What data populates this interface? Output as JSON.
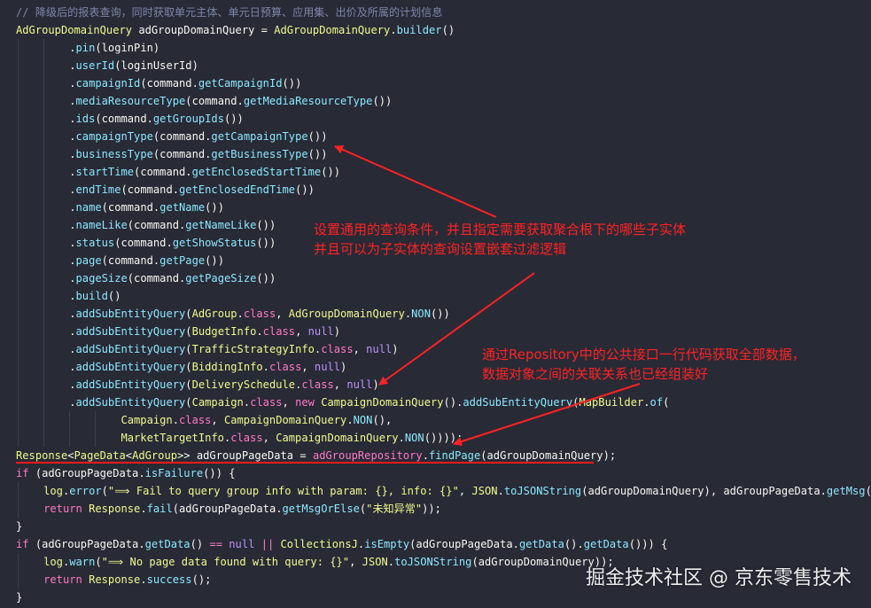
{
  "annotations": {
    "note1_line1": "设置通用的查询条件，并且指定需要获取聚合根下的哪些子实体",
    "note1_line2": "并且可以为子实体的查询设置嵌套过滤逻辑",
    "note2_line1": "通过Repository中的公共接口一行代码获取全部数据，",
    "note2_line2": "数据对象之间的关联关系也已经组装好",
    "color": "#ff2222"
  },
  "watermark": "掘金技术社区 @ 京东零售技术",
  "theme": {
    "background": "#282a36",
    "comment": "#7f86a8",
    "type": "#f1fa8c",
    "function": "#8be9fd",
    "keyword": "#ff79c6",
    "constant": "#bd93f9"
  },
  "code": {
    "lines": [
      {
        "indent": 0,
        "tokens": [
          [
            "cm",
            "// 降级后的报表查询，同时获取单元主体、单元日预算、应用集、出价及所属的计划信息"
          ]
        ]
      },
      {
        "indent": 0,
        "tokens": [
          [
            "ty",
            "AdGroupDomainQuery"
          ],
          [
            "pl",
            " adGroupDomainQuery = "
          ],
          [
            "ty",
            "AdGroupDomainQuery"
          ],
          [
            "pl",
            "."
          ],
          [
            "fn",
            "builder"
          ],
          [
            "pl",
            "()"
          ]
        ]
      },
      {
        "indent": 2,
        "tokens": [
          [
            "pl",
            "."
          ],
          [
            "fn",
            "pin"
          ],
          [
            "pl",
            "(loginPin)"
          ]
        ]
      },
      {
        "indent": 2,
        "tokens": [
          [
            "pl",
            "."
          ],
          [
            "fn",
            "userId"
          ],
          [
            "pl",
            "(loginUserId)"
          ]
        ]
      },
      {
        "indent": 2,
        "tokens": [
          [
            "pl",
            "."
          ],
          [
            "fn",
            "campaignId"
          ],
          [
            "pl",
            "(command."
          ],
          [
            "fn",
            "getCampaignId"
          ],
          [
            "pl",
            "())"
          ]
        ]
      },
      {
        "indent": 2,
        "tokens": [
          [
            "pl",
            "."
          ],
          [
            "fn",
            "mediaResourceType"
          ],
          [
            "pl",
            "(command."
          ],
          [
            "fn",
            "getMediaResourceType"
          ],
          [
            "pl",
            "())"
          ]
        ]
      },
      {
        "indent": 2,
        "tokens": [
          [
            "pl",
            "."
          ],
          [
            "fn",
            "ids"
          ],
          [
            "pl",
            "(command."
          ],
          [
            "fn",
            "getGroupIds"
          ],
          [
            "pl",
            "())"
          ]
        ]
      },
      {
        "indent": 2,
        "tokens": [
          [
            "pl",
            "."
          ],
          [
            "fn",
            "campaignType"
          ],
          [
            "pl",
            "(command."
          ],
          [
            "fn",
            "getCampaignType"
          ],
          [
            "pl",
            "())"
          ]
        ]
      },
      {
        "indent": 2,
        "tokens": [
          [
            "pl",
            "."
          ],
          [
            "fn",
            "businessType"
          ],
          [
            "pl",
            "(command."
          ],
          [
            "fn",
            "getBusinessType"
          ],
          [
            "pl",
            "())"
          ]
        ]
      },
      {
        "indent": 2,
        "tokens": [
          [
            "pl",
            "."
          ],
          [
            "fn",
            "startTime"
          ],
          [
            "pl",
            "(command."
          ],
          [
            "fn",
            "getEnclosedStartTime"
          ],
          [
            "pl",
            "())"
          ]
        ]
      },
      {
        "indent": 2,
        "tokens": [
          [
            "pl",
            "."
          ],
          [
            "fn",
            "endTime"
          ],
          [
            "pl",
            "(command."
          ],
          [
            "fn",
            "getEnclosedEndTime"
          ],
          [
            "pl",
            "())"
          ]
        ]
      },
      {
        "indent": 2,
        "tokens": [
          [
            "pl",
            "."
          ],
          [
            "fn",
            "name"
          ],
          [
            "pl",
            "(command."
          ],
          [
            "fn",
            "getName"
          ],
          [
            "pl",
            "())"
          ]
        ]
      },
      {
        "indent": 2,
        "tokens": [
          [
            "pl",
            "."
          ],
          [
            "fn",
            "nameLike"
          ],
          [
            "pl",
            "(command."
          ],
          [
            "fn",
            "getNameLike"
          ],
          [
            "pl",
            "())"
          ]
        ]
      },
      {
        "indent": 2,
        "tokens": [
          [
            "pl",
            "."
          ],
          [
            "fn",
            "status"
          ],
          [
            "pl",
            "(command."
          ],
          [
            "fn",
            "getShowStatus"
          ],
          [
            "pl",
            "())"
          ]
        ]
      },
      {
        "indent": 2,
        "tokens": [
          [
            "pl",
            "."
          ],
          [
            "fn",
            "page"
          ],
          [
            "pl",
            "(command."
          ],
          [
            "fn",
            "getPage"
          ],
          [
            "pl",
            "())"
          ]
        ]
      },
      {
        "indent": 2,
        "tokens": [
          [
            "pl",
            "."
          ],
          [
            "fn",
            "pageSize"
          ],
          [
            "pl",
            "(command."
          ],
          [
            "fn",
            "getPageSize"
          ],
          [
            "pl",
            "())"
          ]
        ]
      },
      {
        "indent": 2,
        "tokens": [
          [
            "pl",
            "."
          ],
          [
            "fn",
            "build"
          ],
          [
            "pl",
            "()"
          ]
        ]
      },
      {
        "indent": 2,
        "tokens": [
          [
            "pl",
            "."
          ],
          [
            "fn",
            "addSubEntityQuery"
          ],
          [
            "pl",
            "("
          ],
          [
            "ty",
            "AdGroup"
          ],
          [
            "pl",
            "."
          ],
          [
            "kw",
            "class"
          ],
          [
            "pl",
            ", "
          ],
          [
            "ty",
            "AdGroupDomainQuery"
          ],
          [
            "pl",
            "."
          ],
          [
            "fn",
            "NON"
          ],
          [
            "pl",
            "())"
          ]
        ]
      },
      {
        "indent": 2,
        "tokens": [
          [
            "pl",
            "."
          ],
          [
            "fn",
            "addSubEntityQuery"
          ],
          [
            "pl",
            "("
          ],
          [
            "ty",
            "BudgetInfo"
          ],
          [
            "pl",
            "."
          ],
          [
            "kw",
            "class"
          ],
          [
            "pl",
            ", "
          ],
          [
            "nu",
            "null"
          ],
          [
            "pl",
            ")"
          ]
        ]
      },
      {
        "indent": 2,
        "tokens": [
          [
            "pl",
            "."
          ],
          [
            "fn",
            "addSubEntityQuery"
          ],
          [
            "pl",
            "("
          ],
          [
            "ty",
            "TrafficStrategyInfo"
          ],
          [
            "pl",
            "."
          ],
          [
            "kw",
            "class"
          ],
          [
            "pl",
            ", "
          ],
          [
            "nu",
            "null"
          ],
          [
            "pl",
            ")"
          ]
        ]
      },
      {
        "indent": 2,
        "tokens": [
          [
            "pl",
            "."
          ],
          [
            "fn",
            "addSubEntityQuery"
          ],
          [
            "pl",
            "("
          ],
          [
            "ty",
            "BiddingInfo"
          ],
          [
            "pl",
            "."
          ],
          [
            "kw",
            "class"
          ],
          [
            "pl",
            ", "
          ],
          [
            "nu",
            "null"
          ],
          [
            "pl",
            ")"
          ]
        ]
      },
      {
        "indent": 2,
        "tokens": [
          [
            "pl",
            "."
          ],
          [
            "fn",
            "addSubEntityQuery"
          ],
          [
            "pl",
            "("
          ],
          [
            "ty",
            "DeliverySchedule"
          ],
          [
            "pl",
            "."
          ],
          [
            "kw",
            "class"
          ],
          [
            "pl",
            ", "
          ],
          [
            "nu",
            "null"
          ],
          [
            "pl",
            ")"
          ]
        ]
      },
      {
        "indent": 2,
        "tokens": [
          [
            "pl",
            "."
          ],
          [
            "fn",
            "addSubEntityQuery"
          ],
          [
            "pl",
            "("
          ],
          [
            "ty",
            "Campaign"
          ],
          [
            "pl",
            "."
          ],
          [
            "kw",
            "class"
          ],
          [
            "pl",
            ", "
          ],
          [
            "kw",
            "new"
          ],
          [
            "pl",
            " "
          ],
          [
            "ty",
            "CampaignDomainQuery"
          ],
          [
            "pl",
            "()."
          ],
          [
            "fn",
            "addSubEntityQuery"
          ],
          [
            "pl",
            "("
          ],
          [
            "ty",
            "MapBuilder"
          ],
          [
            "pl",
            "."
          ],
          [
            "fn",
            "of"
          ],
          [
            "pl",
            "("
          ]
        ]
      },
      {
        "indent": 4,
        "tokens": [
          [
            "ty",
            "Campaign"
          ],
          [
            "pl",
            "."
          ],
          [
            "kw",
            "class"
          ],
          [
            "pl",
            ", "
          ],
          [
            "ty",
            "CampaignDomainQuery"
          ],
          [
            "pl",
            "."
          ],
          [
            "fn",
            "NON"
          ],
          [
            "pl",
            "(),"
          ]
        ]
      },
      {
        "indent": 4,
        "tokens": [
          [
            "ty",
            "MarketTargetInfo"
          ],
          [
            "pl",
            "."
          ],
          [
            "kw",
            "class"
          ],
          [
            "pl",
            ", "
          ],
          [
            "ty",
            "CampaignDomainQuery"
          ],
          [
            "pl",
            "."
          ],
          [
            "fn",
            "NON"
          ],
          [
            "pl",
            "())));"
          ]
        ]
      },
      {
        "indent": 0,
        "tokens": [
          [
            "ty",
            "Response"
          ],
          [
            "pl",
            "<"
          ],
          [
            "ty",
            "PageData"
          ],
          [
            "pl",
            "<"
          ],
          [
            "ty",
            "AdGroup"
          ],
          [
            "pl",
            ">> adGroupPageData = "
          ],
          [
            "kw",
            "adGroupRepository"
          ],
          [
            "pl",
            "."
          ],
          [
            "fn",
            "findPage"
          ],
          [
            "pl",
            "(adGroupDomainQuery);"
          ]
        ]
      },
      {
        "indent": 0,
        "tokens": [
          [
            "kw",
            "if"
          ],
          [
            "pl",
            " (adGroupPageData."
          ],
          [
            "fn",
            "isFailure"
          ],
          [
            "pl",
            "()) {"
          ]
        ]
      },
      {
        "indent": 1,
        "tokens": [
          [
            "ty",
            "log"
          ],
          [
            "pl",
            "."
          ],
          [
            "fn",
            "error"
          ],
          [
            "pl",
            "("
          ],
          [
            "st",
            "\"⟹ Fail to query group info with param: {}, info: {}\""
          ],
          [
            "pl",
            ", "
          ],
          [
            "ty",
            "JSON"
          ],
          [
            "pl",
            "."
          ],
          [
            "fn",
            "toJSONString"
          ],
          [
            "pl",
            "(adGroupDomainQuery), adGroupPageData."
          ],
          [
            "fn",
            "getMsg"
          ],
          [
            "pl",
            "());"
          ]
        ]
      },
      {
        "indent": 1,
        "tokens": [
          [
            "kw",
            "return"
          ],
          [
            "pl",
            " "
          ],
          [
            "ty",
            "Response"
          ],
          [
            "pl",
            "."
          ],
          [
            "fn",
            "fail"
          ],
          [
            "pl",
            "(adGroupPageData."
          ],
          [
            "fn",
            "getMsgOrElse"
          ],
          [
            "pl",
            "("
          ],
          [
            "st",
            "\"未知异常\""
          ],
          [
            "pl",
            "));"
          ]
        ]
      },
      {
        "indent": 0,
        "tokens": [
          [
            "pl",
            "}"
          ]
        ]
      },
      {
        "indent": 0,
        "tokens": [
          [
            "kw",
            "if"
          ],
          [
            "pl",
            " (adGroupPageData."
          ],
          [
            "fn",
            "getData"
          ],
          [
            "pl",
            "() "
          ],
          [
            "op",
            "=="
          ],
          [
            "pl",
            " "
          ],
          [
            "nu",
            "null"
          ],
          [
            "pl",
            " "
          ],
          [
            "op",
            "||"
          ],
          [
            "pl",
            " "
          ],
          [
            "ty",
            "CollectionsJ"
          ],
          [
            "pl",
            "."
          ],
          [
            "fn",
            "isEmpty"
          ],
          [
            "pl",
            "(adGroupPageData."
          ],
          [
            "fn",
            "getData"
          ],
          [
            "pl",
            "()."
          ],
          [
            "fn",
            "getData"
          ],
          [
            "pl",
            "())) {"
          ]
        ]
      },
      {
        "indent": 1,
        "tokens": [
          [
            "ty",
            "log"
          ],
          [
            "pl",
            "."
          ],
          [
            "fn",
            "warn"
          ],
          [
            "pl",
            "("
          ],
          [
            "st",
            "\"⟹ No page data found with query: {}\""
          ],
          [
            "pl",
            ", "
          ],
          [
            "ty",
            "JSON"
          ],
          [
            "pl",
            "."
          ],
          [
            "fn",
            "toJSONString"
          ],
          [
            "pl",
            "(adGroupDomainQuery));"
          ]
        ]
      },
      {
        "indent": 1,
        "tokens": [
          [
            "kw",
            "return"
          ],
          [
            "pl",
            " "
          ],
          [
            "ty",
            "Response"
          ],
          [
            "pl",
            "."
          ],
          [
            "fn",
            "success"
          ],
          [
            "pl",
            "();"
          ]
        ]
      },
      {
        "indent": 0,
        "tokens": [
          [
            "pl",
            "}"
          ]
        ]
      }
    ]
  }
}
